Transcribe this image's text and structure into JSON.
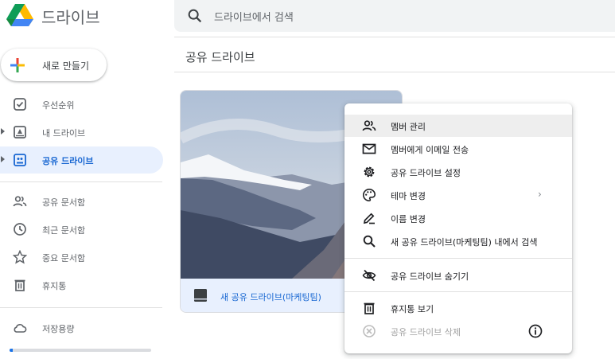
{
  "app": {
    "title": "드라이브"
  },
  "search": {
    "placeholder": "드라이브에서 검색"
  },
  "new_button": {
    "label": "새로 만들기"
  },
  "sidebar": {
    "items": [
      {
        "label": "우선순위",
        "icon": "check-box-icon"
      },
      {
        "label": "내 드라이브",
        "icon": "my-drive-icon"
      },
      {
        "label": "공유 드라이브",
        "icon": "shared-drive-icon"
      },
      {
        "label": "공유 문서함",
        "icon": "people-icon"
      },
      {
        "label": "최근 문서함",
        "icon": "clock-icon"
      },
      {
        "label": "중요 문서함",
        "icon": "star-icon"
      },
      {
        "label": "휴지통",
        "icon": "trash-icon"
      },
      {
        "label": "저장용량",
        "icon": "cloud-icon"
      }
    ],
    "active_index": 2,
    "storage_used_fraction": 0.02
  },
  "main": {
    "title": "공유 드라이브",
    "drives": [
      {
        "name": "새 공유 드라이브(마케팅팀)"
      }
    ]
  },
  "context_menu": {
    "items": [
      {
        "label": "멤버 관리",
        "icon": "people-icon",
        "hover": true
      },
      {
        "label": "멤버에게 이메일 전송",
        "icon": "mail-icon"
      },
      {
        "label": "공유 드라이브 설정",
        "icon": "gear-icon"
      },
      {
        "label": "테마 변경",
        "icon": "palette-icon",
        "submenu_glyph": "›"
      },
      {
        "label": "이름 변경",
        "icon": "pencil-icon"
      },
      {
        "label": "새 공유 드라이브(마케팅팀) 내에서 검색",
        "icon": "search-icon"
      },
      {
        "label": "공유 드라이브 숨기기",
        "icon": "eye-off-icon"
      },
      {
        "label": "휴지통 보기",
        "icon": "trash-icon"
      },
      {
        "label": "공유 드라이브 삭제",
        "icon": "remove-circle-icon",
        "disabled": true
      }
    ]
  },
  "colors": {
    "accent": "#1967d2",
    "active_bg": "#e8f0fe",
    "text": "#3c4043"
  }
}
